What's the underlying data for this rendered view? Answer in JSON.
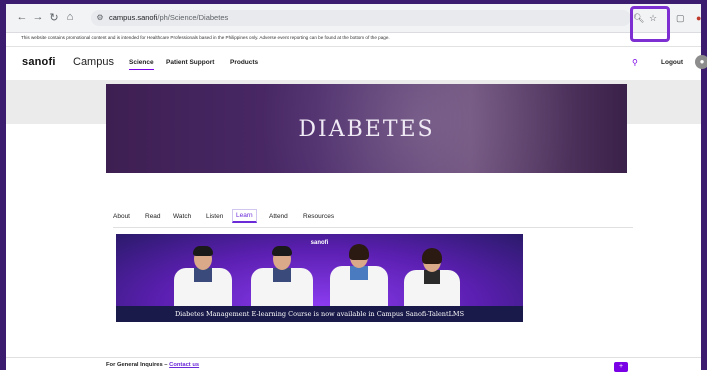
{
  "browser": {
    "url_host": "campus.sanofi",
    "url_path": "/ph/Science/Diabetes",
    "icons": [
      "back-icon",
      "forward-icon",
      "reload-icon",
      "home-icon",
      "site-info-icon",
      "zoom-icon",
      "bookmark-star-icon",
      "extensions-icon",
      "profile-icon"
    ]
  },
  "notice": "This website contains promotional content and is intended for Healthcare Professionals based in the Philippines only. Adverse event reporting can be found at the bottom of the page.",
  "site": {
    "logo": "sanofi",
    "campus": "Campus",
    "nav": [
      "Science",
      "Patient Support",
      "Products"
    ],
    "logout": "Logout"
  },
  "banner": {
    "title": "DIABETES"
  },
  "tabs": [
    "About",
    "Read",
    "Watch",
    "Listen",
    "Learn",
    "Attend",
    "Resources"
  ],
  "promo": {
    "brand": "sanofi",
    "caption": "Diabetes Management E-learning Course is now available in Campus Sanofi-TalentLMS"
  },
  "footer": {
    "text": "For General Inquires – ",
    "link": "Contact us"
  },
  "colors": {
    "accent": "#7a00e6",
    "frame": "#3b1c6e",
    "highlight": "#7e2fd1"
  }
}
